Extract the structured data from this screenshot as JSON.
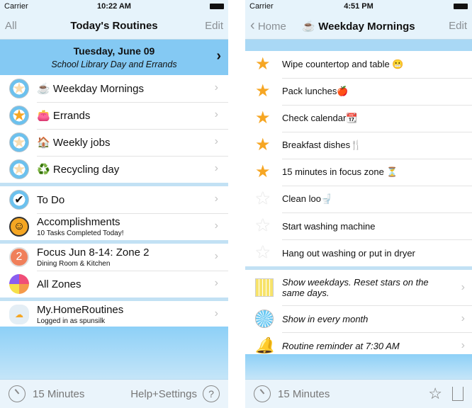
{
  "left": {
    "status": {
      "carrier": "Carrier",
      "time": "10:22 AM"
    },
    "nav": {
      "left": "All",
      "title": "Today's Routines",
      "right": "Edit"
    },
    "banner": {
      "date": "Tuesday, June 09",
      "subtitle": "School Library Day and Errands"
    },
    "routines": [
      {
        "emoji": "☕",
        "label": "Weekday Mornings"
      },
      {
        "emoji": "👛",
        "label": "Errands"
      },
      {
        "emoji": "🏠",
        "label": "Weekly jobs"
      },
      {
        "emoji": "♻️",
        "label": "Recycling day"
      }
    ],
    "todo": {
      "label": "To Do"
    },
    "accomplishments": {
      "label": "Accomplishments",
      "sub": "10 Tasks Completed Today!"
    },
    "focus": {
      "badge": "2",
      "label": "Focus Jun 8-14: Zone 2",
      "sub": "Dining Room & Kitchen"
    },
    "zones": {
      "label": "All Zones"
    },
    "account": {
      "label": "My.HomeRoutines",
      "sub": "Logged in as spunsilk"
    },
    "toolbar": {
      "timer": "15 Minutes",
      "help": "Help+Settings",
      "help_icon": "?"
    }
  },
  "right": {
    "status": {
      "carrier": "Carrier",
      "time": "4:51 PM"
    },
    "nav": {
      "back": "Home",
      "title": "☕ Weekday Mornings",
      "right": "Edit"
    },
    "tasks": [
      {
        "label": "Wipe countertop and table 😬",
        "starred": true
      },
      {
        "label": "Pack lunches🍎",
        "starred": true
      },
      {
        "label": "Check calendar📆",
        "starred": true
      },
      {
        "label": "Breakfast dishes🍴",
        "starred": true
      },
      {
        "label": "15 minutes in focus zone ⏳",
        "starred": true
      },
      {
        "label": "Clean loo🚽",
        "starred": false
      },
      {
        "label": "Start washing machine",
        "starred": false
      },
      {
        "label": "Hang out washing or put in dryer",
        "starred": false
      }
    ],
    "settings": [
      {
        "label": "Show weekdays. Reset stars on the same days.",
        "icon": "calendar-icon"
      },
      {
        "label": "Show in every month",
        "icon": "month-wheel-icon"
      },
      {
        "label": "Routine reminder at 7:30 AM",
        "icon": "bell-icon"
      }
    ],
    "toolbar": {
      "timer": "15 Minutes"
    }
  },
  "colors": {
    "banner": "#84c9f3",
    "star": "#f6a623",
    "nav_bg": "#e6f3fb"
  }
}
